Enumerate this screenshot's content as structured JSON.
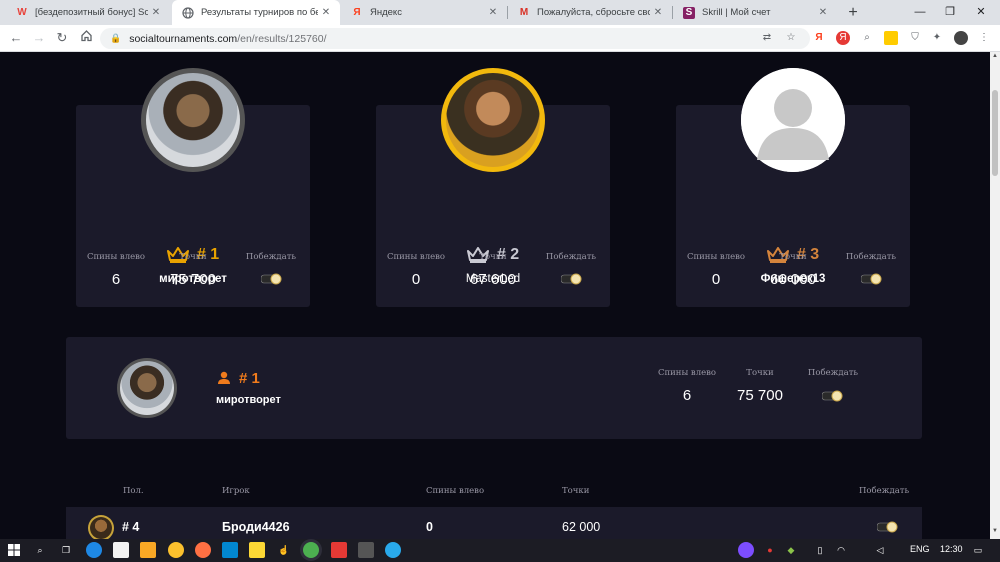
{
  "browser": {
    "tabs": [
      {
        "title": "[бездепозитный бонус] Social",
        "favicon": "W",
        "favicon_color": "#e8423a",
        "active": false
      },
      {
        "title": "Результаты турниров по бес",
        "favicon": "globe-icon",
        "active": true
      },
      {
        "title": "Яндекс",
        "favicon": "Я",
        "favicon_color": "#fc3f1d",
        "active": false
      },
      {
        "title": "Пожалуйста, сбросьте свой п",
        "favicon": "M",
        "favicon_color": "#d93025",
        "active": false
      },
      {
        "title": "Skrill | Мой счет",
        "favicon": "S",
        "favicon_color": "#862165",
        "active": false
      }
    ],
    "url_host": "socialtournaments.com",
    "url_path": "/en/results/125760/"
  },
  "podium": [
    {
      "rank": "# 1",
      "name": "миротворет",
      "spins_left": "6",
      "points": "75 700",
      "ring_color": "#5a5a5a",
      "rank_color": "#e8a200",
      "avatar": "avatar-1"
    },
    {
      "rank": "# 2",
      "name": "MasterLed",
      "spins_left": "0",
      "points": "67 600",
      "ring_color": "#f2b90d",
      "rank_color": "#c9c9d2",
      "avatar": "avatar-2"
    },
    {
      "rank": "# 3",
      "name": "Фишерек13",
      "spins_left": "0",
      "points": "66 000",
      "ring_color": "#f4f4f4",
      "rank_color": "#d4843c",
      "avatar": "avatar-default"
    }
  ],
  "labels": {
    "spins_left": "Спины влево",
    "points": "Точки",
    "win": "Побеждать"
  },
  "my_result": {
    "rank": "# 1",
    "name": "миротворет",
    "spins_left": "6",
    "points": "75 700"
  },
  "table": {
    "headers": {
      "pos": "Пол.",
      "player": "Игрок",
      "spins_left": "Спины влево",
      "points": "Точки",
      "win": "Побеждать"
    },
    "rows": [
      {
        "rank": "# 4",
        "name": "Броди4426",
        "spins_left": "0",
        "points": "62 000"
      }
    ]
  },
  "taskbar": {
    "lang": "ENG",
    "time": "12:30"
  }
}
